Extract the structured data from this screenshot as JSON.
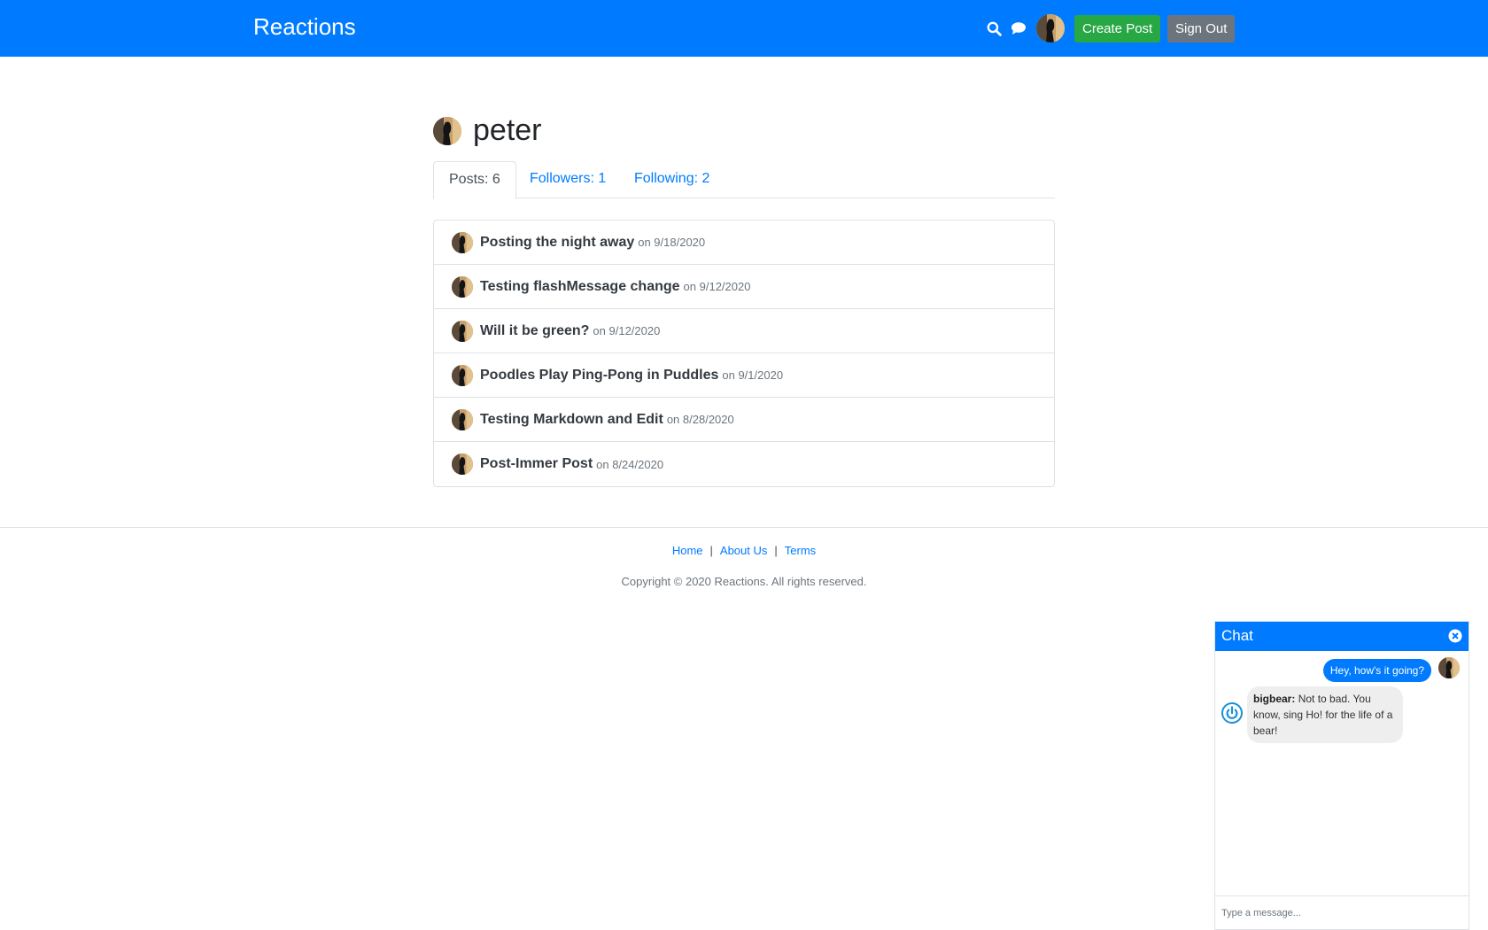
{
  "header": {
    "brand": "Reactions",
    "create_post_label": "Create Post",
    "sign_out_label": "Sign Out",
    "bg_color": "#007bff"
  },
  "profile": {
    "username": "peter",
    "tabs": [
      {
        "label": "Posts: 6",
        "active": true
      },
      {
        "label": "Followers: 1",
        "active": false
      },
      {
        "label": "Following: 2",
        "active": false
      }
    ]
  },
  "posts": [
    {
      "title": "Posting the night away",
      "date": "on 9/18/2020"
    },
    {
      "title": "Testing flashMessage change",
      "date": "on 9/12/2020"
    },
    {
      "title": "Will it be green?",
      "date": "on 9/12/2020"
    },
    {
      "title": "Poodles Play Ping-Pong in Puddles",
      "date": "on 9/1/2020"
    },
    {
      "title": "Testing Markdown and Edit",
      "date": "on 8/28/2020"
    },
    {
      "title": "Post-Immer Post",
      "date": "on 8/24/2020"
    }
  ],
  "footer": {
    "links": [
      "Home",
      "About Us",
      "Terms"
    ],
    "separator": "|",
    "copyright": "Copyright © 2020 Reactions. All rights reserved."
  },
  "chat": {
    "title": "Chat",
    "self_message": "Hey, how's it going?",
    "other_user": "bigbear:",
    "other_message": "Not to bad. You know, sing Ho! for the life of a bear!",
    "input_placeholder": "Type a message..."
  },
  "icons": {
    "search": "search-icon",
    "chat": "chat-bubble-icon",
    "close": "close-circle-icon",
    "avatar_default": "power-icon"
  }
}
